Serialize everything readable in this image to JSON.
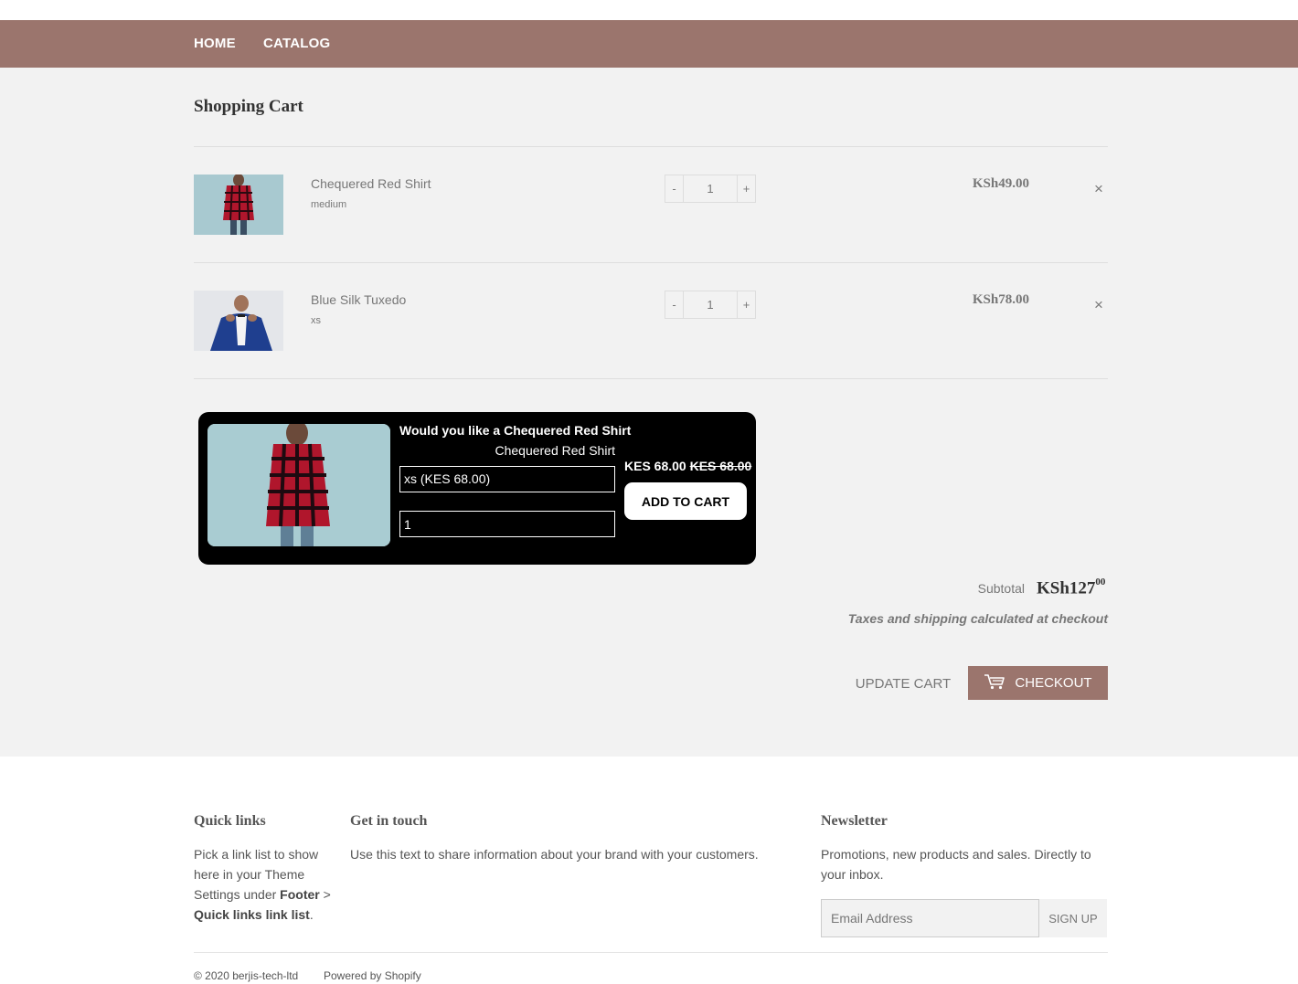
{
  "nav": {
    "home": "HOME",
    "catalog": "CATALOG"
  },
  "colors": {
    "brand": "#9b756d",
    "page_bg": "#f2f2f2",
    "upsell_bg": "#000000"
  },
  "cart": {
    "title": "Shopping Cart",
    "items": [
      {
        "title": "Chequered Red Shirt",
        "variant": "medium",
        "quantity": "1",
        "price": "KSh49.00",
        "minus": "-",
        "plus": "+",
        "remove": "×"
      },
      {
        "title": "Blue Silk Tuxedo",
        "variant": "xs",
        "quantity": "1",
        "price": "KSh78.00",
        "minus": "-",
        "plus": "+",
        "remove": "×"
      }
    ],
    "subtotal_label": "Subtotal",
    "subtotal_main": "KSh127",
    "subtotal_cents": "00",
    "tax_note": "Taxes and shipping calculated at checkout",
    "update_label": "UPDATE CART",
    "checkout_label": "CHECKOUT"
  },
  "upsell": {
    "question": "Would you like a Chequered Red Shirt",
    "product_name": "Chequered Red Shirt",
    "selected_option": "xs (KES 68.00)",
    "quantity": "1",
    "price": "KES 68.00",
    "compare_price": "KES 68.00",
    "add_label": "ADD TO CART"
  },
  "footer": {
    "quick_links": {
      "heading": "Quick links",
      "text_before": "Pick a link list to show here in your Theme Settings under ",
      "bold1": "Footer",
      "sep": " > ",
      "bold2": "Quick links link list",
      "text_after": "."
    },
    "get_in_touch": {
      "heading": "Get in touch",
      "text": "Use this text to share information about your brand with your customers."
    },
    "newsletter": {
      "heading": "Newsletter",
      "text": "Promotions, new products and sales. Directly to your inbox.",
      "email_placeholder": "Email Address",
      "signup_label": "SIGN UP"
    },
    "copyright": "© 2020 berjis-tech-ltd",
    "powered": "Powered by Shopify"
  }
}
